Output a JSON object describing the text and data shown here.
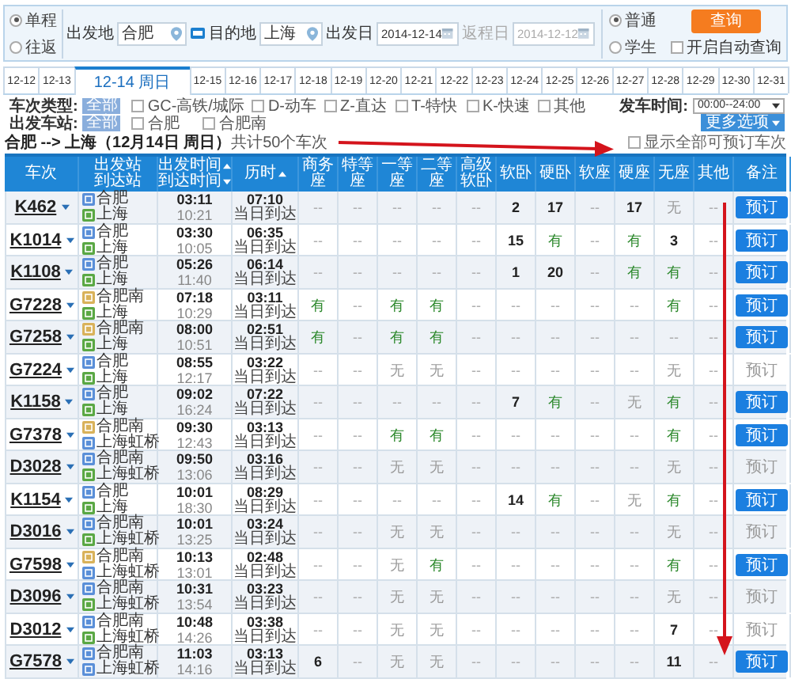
{
  "trip_type": [
    {
      "label": "单程",
      "selected": true
    },
    {
      "label": "往返",
      "selected": false
    }
  ],
  "from": {
    "label": "出发地",
    "value": "合肥"
  },
  "to": {
    "label": "目的地",
    "value": "上海"
  },
  "depart_date": {
    "label": "出发日",
    "value": "2014-12-14",
    "disabled": false
  },
  "return_date": {
    "label": "返程日",
    "value": "2014-12-12",
    "disabled": true
  },
  "passenger_type": [
    {
      "label": "普通",
      "selected": true
    },
    {
      "label": "学生",
      "selected": false
    }
  ],
  "search_button": "查询",
  "auto_query": {
    "label": "开启自动查询",
    "checked": false
  },
  "date_tabs": [
    {
      "label": "12-12",
      "selected": false
    },
    {
      "label": "12-13",
      "selected": false
    },
    {
      "label": "12-14 周日",
      "selected": true
    },
    {
      "label": "12-15",
      "selected": false
    },
    {
      "label": "12-16",
      "selected": false
    },
    {
      "label": "12-17",
      "selected": false
    },
    {
      "label": "12-18",
      "selected": false
    },
    {
      "label": "12-19",
      "selected": false
    },
    {
      "label": "12-20",
      "selected": false
    },
    {
      "label": "12-21",
      "selected": false
    },
    {
      "label": "12-22",
      "selected": false
    },
    {
      "label": "12-23",
      "selected": false
    },
    {
      "label": "12-24",
      "selected": false
    },
    {
      "label": "12-25",
      "selected": false
    },
    {
      "label": "12-26",
      "selected": false
    },
    {
      "label": "12-27",
      "selected": false
    },
    {
      "label": "12-28",
      "selected": false
    },
    {
      "label": "12-29",
      "selected": false
    },
    {
      "label": "12-30",
      "selected": false
    },
    {
      "label": "12-31",
      "selected": false
    }
  ],
  "train_types": {
    "label": "车次类型:",
    "all": "全部",
    "options": [
      {
        "label": "GC-高铁/城际",
        "checked": false
      },
      {
        "label": "D-动车",
        "checked": false
      },
      {
        "label": "Z-直达",
        "checked": false
      },
      {
        "label": "T-特快",
        "checked": false
      },
      {
        "label": "K-快速",
        "checked": false
      },
      {
        "label": "其他",
        "checked": false
      }
    ]
  },
  "departure_time": {
    "label": "发车时间:",
    "value": "00:00--24:00"
  },
  "stations": {
    "label": "出发车站:",
    "all": "全部",
    "options": [
      {
        "label": "合肥",
        "checked": false
      },
      {
        "label": "合肥南",
        "checked": false
      }
    ]
  },
  "more_options": "更多选项",
  "summary": "**合肥 --> 上海（12月14日 周日）**共计50个车次",
  "show_all": {
    "label": "显示全部可预订车次",
    "checked": false
  },
  "columns": [
    {
      "lines": [
        {
          "text": "车次"
        }
      ]
    },
    {
      "lines": [
        {
          "text": "出发站"
        },
        {
          "text": "到达站"
        }
      ]
    },
    {
      "lines": [
        {
          "text": "出发时间",
          "kind": "sort-up"
        },
        {
          "text": "到达时间",
          "kind": "sort-down"
        }
      ]
    },
    {
      "lines": [
        {
          "text": "历时",
          "kind": "sort-up"
        }
      ]
    },
    {
      "lines": [
        {
          "text": "商务座"
        }
      ]
    },
    {
      "lines": [
        {
          "text": "特等座"
        }
      ]
    },
    {
      "lines": [
        {
          "text": "一等座"
        }
      ]
    },
    {
      "lines": [
        {
          "text": "二等座"
        }
      ]
    },
    {
      "lines": [
        {
          "text": "高级"
        },
        {
          "text": "软卧"
        }
      ]
    },
    {
      "lines": [
        {
          "text": "软卧"
        }
      ]
    },
    {
      "lines": [
        {
          "text": "硬卧"
        }
      ]
    },
    {
      "lines": [
        {
          "text": "软座"
        }
      ]
    },
    {
      "lines": [
        {
          "text": "硬座"
        }
      ]
    },
    {
      "lines": [
        {
          "text": "无座"
        }
      ]
    },
    {
      "lines": [
        {
          "text": "其他"
        }
      ]
    },
    {
      "lines": [
        {
          "text": "备注"
        }
      ]
    }
  ],
  "rows": [
    {
      "train": "K462",
      "from": {
        "name": "合肥",
        "color": "#5a8fd8"
      },
      "to": {
        "name": "上海",
        "color": "#5aa844"
      },
      "depart": "03:11",
      "arrive": "10:21",
      "duration": "07:10",
      "arrival_day": "当日到达",
      "seats": [
        {
          "text": "--",
          "kind": "none"
        },
        {
          "text": "--",
          "kind": "none"
        },
        {
          "text": "--",
          "kind": "none"
        },
        {
          "text": "--",
          "kind": "none"
        },
        {
          "text": "--",
          "kind": "none"
        },
        {
          "text": "2",
          "kind": "count"
        },
        {
          "text": "17",
          "kind": "count"
        },
        {
          "text": "--",
          "kind": "none"
        },
        {
          "text": "17",
          "kind": "count"
        },
        {
          "text": "无",
          "kind": "no"
        },
        {
          "text": "--",
          "kind": "none"
        }
      ],
      "book": {
        "label": "预订",
        "disabled": false
      }
    },
    {
      "train": "K1014",
      "from": {
        "name": "合肥",
        "color": "#5a8fd8"
      },
      "to": {
        "name": "上海",
        "color": "#5aa844"
      },
      "depart": "03:30",
      "arrive": "10:05",
      "duration": "06:35",
      "arrival_day": "当日到达",
      "seats": [
        {
          "text": "--",
          "kind": "none"
        },
        {
          "text": "--",
          "kind": "none"
        },
        {
          "text": "--",
          "kind": "none"
        },
        {
          "text": "--",
          "kind": "none"
        },
        {
          "text": "--",
          "kind": "none"
        },
        {
          "text": "15",
          "kind": "count"
        },
        {
          "text": "有",
          "kind": "yes"
        },
        {
          "text": "--",
          "kind": "none"
        },
        {
          "text": "有",
          "kind": "yes"
        },
        {
          "text": "3",
          "kind": "count"
        },
        {
          "text": "--",
          "kind": "none"
        }
      ],
      "book": {
        "label": "预订",
        "disabled": false
      }
    },
    {
      "train": "K1108",
      "from": {
        "name": "合肥",
        "color": "#5a8fd8"
      },
      "to": {
        "name": "上海",
        "color": "#5aa844"
      },
      "depart": "05:26",
      "arrive": "11:40",
      "duration": "06:14",
      "arrival_day": "当日到达",
      "seats": [
        {
          "text": "--",
          "kind": "none"
        },
        {
          "text": "--",
          "kind": "none"
        },
        {
          "text": "--",
          "kind": "none"
        },
        {
          "text": "--",
          "kind": "none"
        },
        {
          "text": "--",
          "kind": "none"
        },
        {
          "text": "1",
          "kind": "count"
        },
        {
          "text": "20",
          "kind": "count"
        },
        {
          "text": "--",
          "kind": "none"
        },
        {
          "text": "有",
          "kind": "yes"
        },
        {
          "text": "有",
          "kind": "yes"
        },
        {
          "text": "--",
          "kind": "none"
        }
      ],
      "book": {
        "label": "预订",
        "disabled": false
      }
    },
    {
      "train": "G7228",
      "from": {
        "name": "合肥南",
        "color": "#d9b25a"
      },
      "to": {
        "name": "上海",
        "color": "#5aa844"
      },
      "depart": "07:18",
      "arrive": "10:29",
      "duration": "03:11",
      "arrival_day": "当日到达",
      "seats": [
        {
          "text": "有",
          "kind": "yes"
        },
        {
          "text": "--",
          "kind": "none"
        },
        {
          "text": "有",
          "kind": "yes"
        },
        {
          "text": "有",
          "kind": "yes"
        },
        {
          "text": "--",
          "kind": "none"
        },
        {
          "text": "--",
          "kind": "none"
        },
        {
          "text": "--",
          "kind": "none"
        },
        {
          "text": "--",
          "kind": "none"
        },
        {
          "text": "--",
          "kind": "none"
        },
        {
          "text": "有",
          "kind": "yes"
        },
        {
          "text": "--",
          "kind": "none"
        }
      ],
      "book": {
        "label": "预订",
        "disabled": false
      }
    },
    {
      "train": "G7258",
      "from": {
        "name": "合肥南",
        "color": "#d9b25a"
      },
      "to": {
        "name": "上海",
        "color": "#5aa844"
      },
      "depart": "08:00",
      "arrive": "10:51",
      "duration": "02:51",
      "arrival_day": "当日到达",
      "seats": [
        {
          "text": "有",
          "kind": "yes"
        },
        {
          "text": "--",
          "kind": "none"
        },
        {
          "text": "有",
          "kind": "yes"
        },
        {
          "text": "有",
          "kind": "yes"
        },
        {
          "text": "--",
          "kind": "none"
        },
        {
          "text": "--",
          "kind": "none"
        },
        {
          "text": "--",
          "kind": "none"
        },
        {
          "text": "--",
          "kind": "none"
        },
        {
          "text": "--",
          "kind": "none"
        },
        {
          "text": "--",
          "kind": "none"
        },
        {
          "text": "--",
          "kind": "none"
        }
      ],
      "book": {
        "label": "预订",
        "disabled": false
      }
    },
    {
      "train": "G7224",
      "from": {
        "name": "合肥",
        "color": "#5a8fd8"
      },
      "to": {
        "name": "上海",
        "color": "#5aa844"
      },
      "depart": "08:55",
      "arrive": "12:17",
      "duration": "03:22",
      "arrival_day": "当日到达",
      "seats": [
        {
          "text": "--",
          "kind": "none"
        },
        {
          "text": "--",
          "kind": "none"
        },
        {
          "text": "无",
          "kind": "no"
        },
        {
          "text": "无",
          "kind": "no"
        },
        {
          "text": "--",
          "kind": "none"
        },
        {
          "text": "--",
          "kind": "none"
        },
        {
          "text": "--",
          "kind": "none"
        },
        {
          "text": "--",
          "kind": "none"
        },
        {
          "text": "--",
          "kind": "none"
        },
        {
          "text": "无",
          "kind": "no"
        },
        {
          "text": "--",
          "kind": "none"
        }
      ],
      "book": {
        "label": "预订",
        "disabled": true
      }
    },
    {
      "train": "K1158",
      "from": {
        "name": "合肥",
        "color": "#5a8fd8"
      },
      "to": {
        "name": "上海",
        "color": "#5aa844"
      },
      "depart": "09:02",
      "arrive": "16:24",
      "duration": "07:22",
      "arrival_day": "当日到达",
      "seats": [
        {
          "text": "--",
          "kind": "none"
        },
        {
          "text": "--",
          "kind": "none"
        },
        {
          "text": "--",
          "kind": "none"
        },
        {
          "text": "--",
          "kind": "none"
        },
        {
          "text": "--",
          "kind": "none"
        },
        {
          "text": "7",
          "kind": "count"
        },
        {
          "text": "有",
          "kind": "yes"
        },
        {
          "text": "--",
          "kind": "none"
        },
        {
          "text": "无",
          "kind": "no"
        },
        {
          "text": "有",
          "kind": "yes"
        },
        {
          "text": "--",
          "kind": "none"
        }
      ],
      "book": {
        "label": "预订",
        "disabled": false
      }
    },
    {
      "train": "G7378",
      "from": {
        "name": "合肥南",
        "color": "#d9b25a"
      },
      "to": {
        "name": "上海虹桥",
        "color": "#5a8fd8"
      },
      "depart": "09:30",
      "arrive": "12:43",
      "duration": "03:13",
      "arrival_day": "当日到达",
      "seats": [
        {
          "text": "--",
          "kind": "none"
        },
        {
          "text": "--",
          "kind": "none"
        },
        {
          "text": "有",
          "kind": "yes"
        },
        {
          "text": "有",
          "kind": "yes"
        },
        {
          "text": "--",
          "kind": "none"
        },
        {
          "text": "--",
          "kind": "none"
        },
        {
          "text": "--",
          "kind": "none"
        },
        {
          "text": "--",
          "kind": "none"
        },
        {
          "text": "--",
          "kind": "none"
        },
        {
          "text": "有",
          "kind": "yes"
        },
        {
          "text": "--",
          "kind": "none"
        }
      ],
      "book": {
        "label": "预订",
        "disabled": false
      }
    },
    {
      "train": "D3028",
      "from": {
        "name": "合肥南",
        "color": "#5a8fd8"
      },
      "to": {
        "name": "上海虹桥",
        "color": "#5aa844"
      },
      "depart": "09:50",
      "arrive": "13:06",
      "duration": "03:16",
      "arrival_day": "当日到达",
      "seats": [
        {
          "text": "--",
          "kind": "none"
        },
        {
          "text": "--",
          "kind": "none"
        },
        {
          "text": "无",
          "kind": "no"
        },
        {
          "text": "无",
          "kind": "no"
        },
        {
          "text": "--",
          "kind": "none"
        },
        {
          "text": "--",
          "kind": "none"
        },
        {
          "text": "--",
          "kind": "none"
        },
        {
          "text": "--",
          "kind": "none"
        },
        {
          "text": "--",
          "kind": "none"
        },
        {
          "text": "无",
          "kind": "no"
        },
        {
          "text": "--",
          "kind": "none"
        }
      ],
      "book": {
        "label": "预订",
        "disabled": true
      }
    },
    {
      "train": "K1154",
      "from": {
        "name": "合肥",
        "color": "#5a8fd8"
      },
      "to": {
        "name": "上海",
        "color": "#5aa844"
      },
      "depart": "10:01",
      "arrive": "18:30",
      "duration": "08:29",
      "arrival_day": "当日到达",
      "seats": [
        {
          "text": "--",
          "kind": "none"
        },
        {
          "text": "--",
          "kind": "none"
        },
        {
          "text": "--",
          "kind": "none"
        },
        {
          "text": "--",
          "kind": "none"
        },
        {
          "text": "--",
          "kind": "none"
        },
        {
          "text": "14",
          "kind": "count"
        },
        {
          "text": "有",
          "kind": "yes"
        },
        {
          "text": "--",
          "kind": "none"
        },
        {
          "text": "无",
          "kind": "no"
        },
        {
          "text": "有",
          "kind": "yes"
        },
        {
          "text": "--",
          "kind": "none"
        }
      ],
      "book": {
        "label": "预订",
        "disabled": false
      }
    },
    {
      "train": "D3016",
      "from": {
        "name": "合肥南",
        "color": "#5a8fd8"
      },
      "to": {
        "name": "上海虹桥",
        "color": "#5aa844"
      },
      "depart": "10:01",
      "arrive": "13:25",
      "duration": "03:24",
      "arrival_day": "当日到达",
      "seats": [
        {
          "text": "--",
          "kind": "none"
        },
        {
          "text": "--",
          "kind": "none"
        },
        {
          "text": "无",
          "kind": "no"
        },
        {
          "text": "无",
          "kind": "no"
        },
        {
          "text": "--",
          "kind": "none"
        },
        {
          "text": "--",
          "kind": "none"
        },
        {
          "text": "--",
          "kind": "none"
        },
        {
          "text": "--",
          "kind": "none"
        },
        {
          "text": "--",
          "kind": "none"
        },
        {
          "text": "无",
          "kind": "no"
        },
        {
          "text": "--",
          "kind": "none"
        }
      ],
      "book": {
        "label": "预订",
        "disabled": true
      }
    },
    {
      "train": "G7598",
      "from": {
        "name": "合肥南",
        "color": "#d9b25a"
      },
      "to": {
        "name": "上海虹桥",
        "color": "#5a8fd8"
      },
      "depart": "10:13",
      "arrive": "13:01",
      "duration": "02:48",
      "arrival_day": "当日到达",
      "seats": [
        {
          "text": "--",
          "kind": "none"
        },
        {
          "text": "--",
          "kind": "none"
        },
        {
          "text": "无",
          "kind": "no"
        },
        {
          "text": "有",
          "kind": "yes"
        },
        {
          "text": "--",
          "kind": "none"
        },
        {
          "text": "--",
          "kind": "none"
        },
        {
          "text": "--",
          "kind": "none"
        },
        {
          "text": "--",
          "kind": "none"
        },
        {
          "text": "--",
          "kind": "none"
        },
        {
          "text": "有",
          "kind": "yes"
        },
        {
          "text": "--",
          "kind": "none"
        }
      ],
      "book": {
        "label": "预订",
        "disabled": false
      }
    },
    {
      "train": "D3096",
      "from": {
        "name": "合肥南",
        "color": "#5a8fd8"
      },
      "to": {
        "name": "上海虹桥",
        "color": "#5aa844"
      },
      "depart": "10:31",
      "arrive": "13:54",
      "duration": "03:23",
      "arrival_day": "当日到达",
      "seats": [
        {
          "text": "--",
          "kind": "none"
        },
        {
          "text": "--",
          "kind": "none"
        },
        {
          "text": "无",
          "kind": "no"
        },
        {
          "text": "无",
          "kind": "no"
        },
        {
          "text": "--",
          "kind": "none"
        },
        {
          "text": "--",
          "kind": "none"
        },
        {
          "text": "--",
          "kind": "none"
        },
        {
          "text": "--",
          "kind": "none"
        },
        {
          "text": "--",
          "kind": "none"
        },
        {
          "text": "无",
          "kind": "no"
        },
        {
          "text": "--",
          "kind": "none"
        }
      ],
      "book": {
        "label": "预订",
        "disabled": true
      }
    },
    {
      "train": "D3012",
      "from": {
        "name": "合肥南",
        "color": "#5a8fd8"
      },
      "to": {
        "name": "上海虹桥",
        "color": "#5aa844"
      },
      "depart": "10:48",
      "arrive": "14:26",
      "duration": "03:38",
      "arrival_day": "当日到达",
      "seats": [
        {
          "text": "--",
          "kind": "none"
        },
        {
          "text": "--",
          "kind": "none"
        },
        {
          "text": "无",
          "kind": "no"
        },
        {
          "text": "无",
          "kind": "no"
        },
        {
          "text": "--",
          "kind": "none"
        },
        {
          "text": "--",
          "kind": "none"
        },
        {
          "text": "--",
          "kind": "none"
        },
        {
          "text": "--",
          "kind": "none"
        },
        {
          "text": "--",
          "kind": "none"
        },
        {
          "text": "7",
          "kind": "count"
        },
        {
          "text": "--",
          "kind": "none"
        }
      ],
      "book": {
        "label": "预订",
        "disabled": true
      }
    },
    {
      "train": "G7578",
      "from": {
        "name": "合肥南",
        "color": "#5a8fd8"
      },
      "to": {
        "name": "上海虹桥",
        "color": "#5a8fd8"
      },
      "depart": "11:03",
      "arrive": "14:16",
      "duration": "03:13",
      "arrival_day": "当日到达",
      "seats": [
        {
          "text": "6",
          "kind": "count"
        },
        {
          "text": "--",
          "kind": "none"
        },
        {
          "text": "无",
          "kind": "no"
        },
        {
          "text": "无",
          "kind": "no"
        },
        {
          "text": "--",
          "kind": "none"
        },
        {
          "text": "--",
          "kind": "none"
        },
        {
          "text": "--",
          "kind": "none"
        },
        {
          "text": "--",
          "kind": "none"
        },
        {
          "text": "--",
          "kind": "none"
        },
        {
          "text": "11",
          "kind": "count"
        },
        {
          "text": "--",
          "kind": "none"
        }
      ],
      "book": {
        "label": "预订",
        "disabled": false
      }
    }
  ],
  "annotation_arrows": [
    {
      "kind": "horizontal"
    },
    {
      "kind": "vertical"
    }
  ]
}
